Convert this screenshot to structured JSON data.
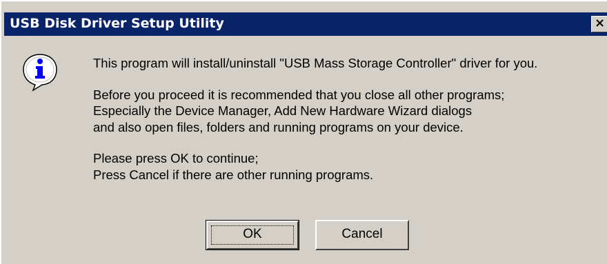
{
  "window": {
    "title": "USB Disk Driver Setup Utility",
    "close_label": "×"
  },
  "message": {
    "line1": "This program will install/uninstall \"USB Mass Storage Controller\" driver for you.",
    "line2": "Before you proceed it is recommended that you close all other programs;",
    "line3": "Especially the Device Manager, Add New Hardware Wizard dialogs",
    "line4": "and also open files, folders and running programs on your device.",
    "line5": "Please press OK to continue;",
    "line6": "Press Cancel if there are other running programs."
  },
  "buttons": {
    "ok_label": "OK",
    "cancel_label": "Cancel"
  },
  "icon": {
    "name": "info-icon",
    "color": "#0000ff"
  }
}
